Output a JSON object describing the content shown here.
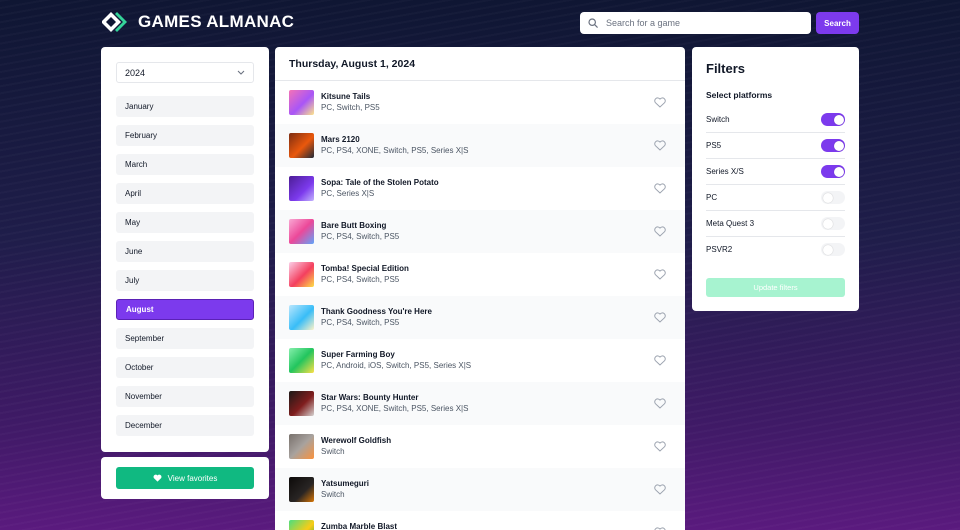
{
  "app": {
    "title": "GAMES ALMANAC"
  },
  "search": {
    "placeholder": "Search for a game",
    "button_label": "Search"
  },
  "sidebar": {
    "year": "2024",
    "months": [
      "January",
      "February",
      "March",
      "April",
      "May",
      "June",
      "July",
      "August",
      "September",
      "October",
      "November",
      "December"
    ],
    "active_month": "August",
    "favorites_label": "View favorites"
  },
  "main": {
    "date_heading": "Thursday, August 1, 2024",
    "games": [
      {
        "title": "Kitsune Tails",
        "platforms": "PC, Switch, PS5"
      },
      {
        "title": "Mars 2120",
        "platforms": "PC, PS4, XONE, Switch, PS5, Series X|S"
      },
      {
        "title": "Sopa: Tale of the Stolen Potato",
        "platforms": "PC, Series X|S"
      },
      {
        "title": "Bare Butt Boxing",
        "platforms": "PC, PS4, Switch, PS5"
      },
      {
        "title": "Tomba! Special Edition",
        "platforms": "PC, PS4, Switch, PS5"
      },
      {
        "title": "Thank Goodness You're Here",
        "platforms": "PC, PS4, Switch, PS5"
      },
      {
        "title": "Super Farming Boy",
        "platforms": "PC, Android, iOS, Switch, PS5, Series X|S"
      },
      {
        "title": "Star Wars: Bounty Hunter",
        "platforms": "PC, PS4, XONE, Switch, PS5, Series X|S"
      },
      {
        "title": "Werewolf Goldfish",
        "platforms": "Switch"
      },
      {
        "title": "Yatsumeguri",
        "platforms": "Switch"
      },
      {
        "title": "Zumba Marble Blast",
        "platforms": ""
      }
    ]
  },
  "filters": {
    "title": "Filters",
    "subtitle": "Select platforms",
    "platforms": [
      {
        "label": "Switch",
        "enabled": true
      },
      {
        "label": "PS5",
        "enabled": true
      },
      {
        "label": "Series X/S",
        "enabled": true
      },
      {
        "label": "PC",
        "enabled": false
      },
      {
        "label": "Meta Quest 3",
        "enabled": false
      },
      {
        "label": "PSVR2",
        "enabled": false
      }
    ],
    "update_label": "Update filters"
  },
  "colors": {
    "accent": "#7c3aed",
    "success": "#10b981",
    "success_disabled": "#a7f3d0"
  }
}
